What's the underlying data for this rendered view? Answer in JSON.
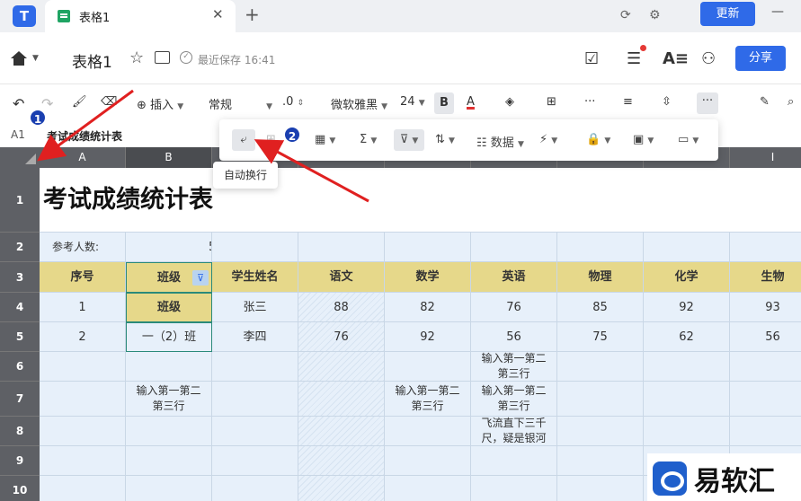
{
  "app": {
    "tab_title": "表格1",
    "update_label": "更新",
    "min_symbol": "—"
  },
  "doc": {
    "title": "表格1",
    "saved_text": "最近保存 16:41",
    "share_label": "分享"
  },
  "toolbar": {
    "insert_label": "插入",
    "format_label": "常规",
    "decimal_label": ".0",
    "font_name": "微软雅黑",
    "font_size": "24",
    "bold_label": "B",
    "font_color_label": "A",
    "more_label": "···",
    "overflow_label": "···"
  },
  "formula": {
    "cell_ref": "A1",
    "content": "考试成绩统计表"
  },
  "float_toolbar": {
    "sum_label": "Σ",
    "data_label": "数据",
    "tooltip": "自动换行"
  },
  "annotations": {
    "badge1": "1",
    "badge2": "2"
  },
  "watermark": {
    "text": "易软汇"
  },
  "sheet": {
    "columns": [
      "A",
      "B",
      "C",
      "D",
      "E",
      "F",
      "G",
      "H",
      "I"
    ],
    "rows": [
      "1",
      "2",
      "3",
      "4",
      "5",
      "6",
      "7",
      "8",
      "9",
      "10"
    ],
    "title": "考试成绩统计表",
    "count_label": "参考人数:",
    "count_value": "5",
    "headers": [
      "序号",
      "班级",
      "学生姓名",
      "语文",
      "数学",
      "英语",
      "物理",
      "化学",
      "生物"
    ],
    "data": [
      [
        "1",
        "班级",
        "张三",
        "88",
        "82",
        "76",
        "85",
        "92",
        "93"
      ],
      [
        "2",
        "一（2）班",
        "李四",
        "76",
        "92",
        "56",
        "75",
        "62",
        "56"
      ]
    ],
    "wrap_text_6": "输入第一第二第三行",
    "wrap_text_7": "输入第一第二第三行",
    "wrap_text_8": "飞流直下三千尺，疑是银河"
  },
  "colors": {
    "accent": "#2f6ae8",
    "header_fill": "#e6d88a",
    "cell_fill": "#e7f0fa",
    "grid_header": "#5e6065",
    "arrow": "#e02020"
  }
}
